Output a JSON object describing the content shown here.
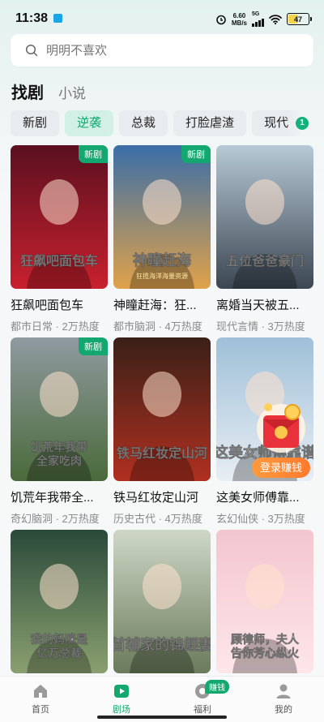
{
  "status_bar": {
    "time": "11:38",
    "net_speed_value": "6.60",
    "net_speed_unit": "MB/s",
    "network": "5G",
    "battery": "47"
  },
  "search": {
    "placeholder": "明明不喜欢"
  },
  "main_tabs": [
    {
      "label": "找剧",
      "active": true
    },
    {
      "label": "小说",
      "active": false
    }
  ],
  "categories": [
    {
      "label": "新剧",
      "active": false
    },
    {
      "label": "逆袭",
      "active": true
    },
    {
      "label": "总裁",
      "active": false
    },
    {
      "label": "打脸虐渣",
      "active": false
    },
    {
      "label": "现代",
      "active": false
    }
  ],
  "category_badge": "1",
  "dramas": [
    {
      "title": "狂飙吧面包车",
      "meta": "都市日常 · 2万热度",
      "tag": "新剧",
      "poster_text": "狂飙吧面包车",
      "colors": [
        "#5a1020",
        "#c8202e"
      ]
    },
    {
      "title": "神瞳赶海：狂...",
      "meta": "都市脑洞 · 4万热度",
      "tag": "新剧",
      "poster_text": "神瞳赶海",
      "poster_sub": "狂揽海洋海量资源",
      "colors": [
        "#3a6ea8",
        "#e0a24a"
      ]
    },
    {
      "title": "离婚当天被五...",
      "meta": "现代言情 · 3万热度",
      "tag": "",
      "poster_text": "五位爸爸豪门",
      "colors": [
        "#b7c9d6",
        "#3b4652"
      ]
    },
    {
      "title": "饥荒年我带全...",
      "meta": "奇幻脑洞 · 2万热度",
      "tag": "新剧",
      "poster_text": "饥荒年我带全家吃肉",
      "colors": [
        "#8f9aa0",
        "#4a6a3a"
      ]
    },
    {
      "title": "铁马红妆定山河",
      "meta": "历史古代 · 4万热度",
      "tag": "",
      "poster_text": "铁马红妆定山河",
      "colors": [
        "#3a2018",
        "#b03020"
      ]
    },
    {
      "title": "这美女师傅靠...",
      "meta": "玄幻仙侠 · 3万热度",
      "tag": "",
      "poster_text": "这美女师傅靠谱",
      "colors": [
        "#9fc0d8",
        "#e8eef4"
      ]
    },
    {
      "title": "",
      "meta": "",
      "tag": "",
      "poster_text": "我的妈咪是亿万总裁",
      "colors": [
        "#2a4a3a",
        "#8aa070"
      ]
    },
    {
      "title": "",
      "meta": "",
      "tag": "",
      "poster_text": "首辅家的锦鲤妻",
      "colors": [
        "#cfd8c8",
        "#6a7a5a"
      ]
    },
    {
      "title": "",
      "meta": "",
      "tag": "",
      "poster_text": "顾律师，夫人告你芳心纵火",
      "colors": [
        "#f4c6cf",
        "#fde6ea"
      ]
    }
  ],
  "login_float": {
    "label": "登录赚钱"
  },
  "bottom_nav": [
    {
      "label": "首页",
      "icon": "home-icon",
      "active": false
    },
    {
      "label": "剧场",
      "icon": "play-icon",
      "active": true
    },
    {
      "label": "福利",
      "icon": "coin-icon",
      "active": false,
      "badge": "赚钱"
    },
    {
      "label": "我的",
      "icon": "person-icon",
      "active": false
    }
  ],
  "accent_color": "#12a86f"
}
